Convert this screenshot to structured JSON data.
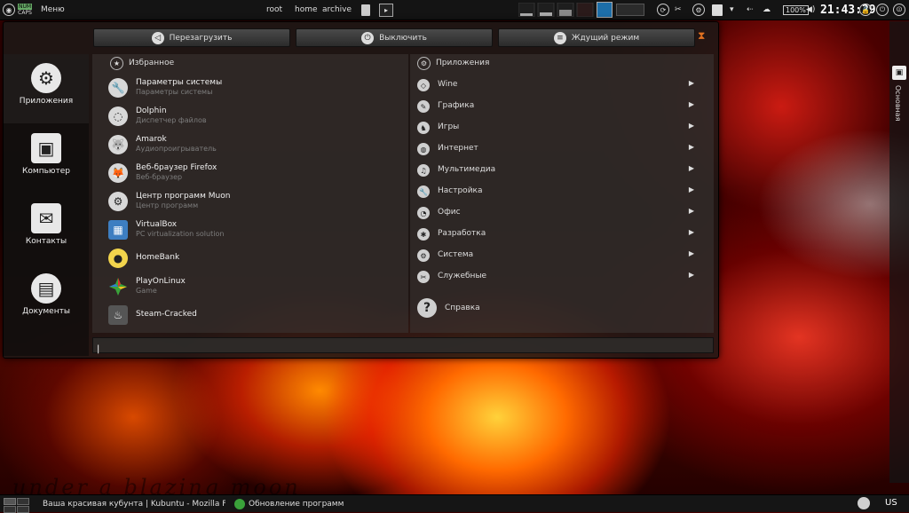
{
  "top_panel": {
    "indicator_text": "CAPS",
    "menu_label": "Меню",
    "places": [
      "root",
      "home",
      "archive"
    ],
    "volume": "100%",
    "clock": "21:43:29"
  },
  "power": {
    "restart": "Перезагрузить",
    "shutdown": "Выключить",
    "sleep": "Ждущий режим"
  },
  "sidebar": [
    {
      "label": "Приложения"
    },
    {
      "label": "Компьютер"
    },
    {
      "label": "Контакты"
    },
    {
      "label": "Документы"
    }
  ],
  "favorites": {
    "header": "Избранное",
    "items": [
      {
        "name": "Параметры системы",
        "desc": "Параметры системы"
      },
      {
        "name": "Dolphin",
        "desc": "Диспетчер файлов"
      },
      {
        "name": "Amarok",
        "desc": "Аудиопроигрыватель"
      },
      {
        "name": "Веб-браузер Firefox",
        "desc": "Веб-браузер"
      },
      {
        "name": "Центр программ Muon",
        "desc": "Центр программ"
      },
      {
        "name": "VirtualBox",
        "desc": "PC virtualization solution"
      },
      {
        "name": "HomeBank",
        "desc": ""
      },
      {
        "name": "PlayOnLinux",
        "desc": "Game"
      },
      {
        "name": "Steam-Cracked",
        "desc": ""
      }
    ]
  },
  "applications": {
    "header": "Приложения",
    "categories": [
      "Wine",
      "Графика",
      "Игры",
      "Интернет",
      "Мультимедиа",
      "Настройка",
      "Офис",
      "Разработка",
      "Система",
      "Служебные"
    ],
    "help": "Справка"
  },
  "dock": {
    "label": "Основная"
  },
  "taskbar": {
    "tasks": [
      "Ваша красивая кубунта | Kubuntu - Mozilla Firefox",
      "Обновление программ"
    ],
    "layout": "US"
  },
  "wallpaper_text": "under a blazing moon"
}
